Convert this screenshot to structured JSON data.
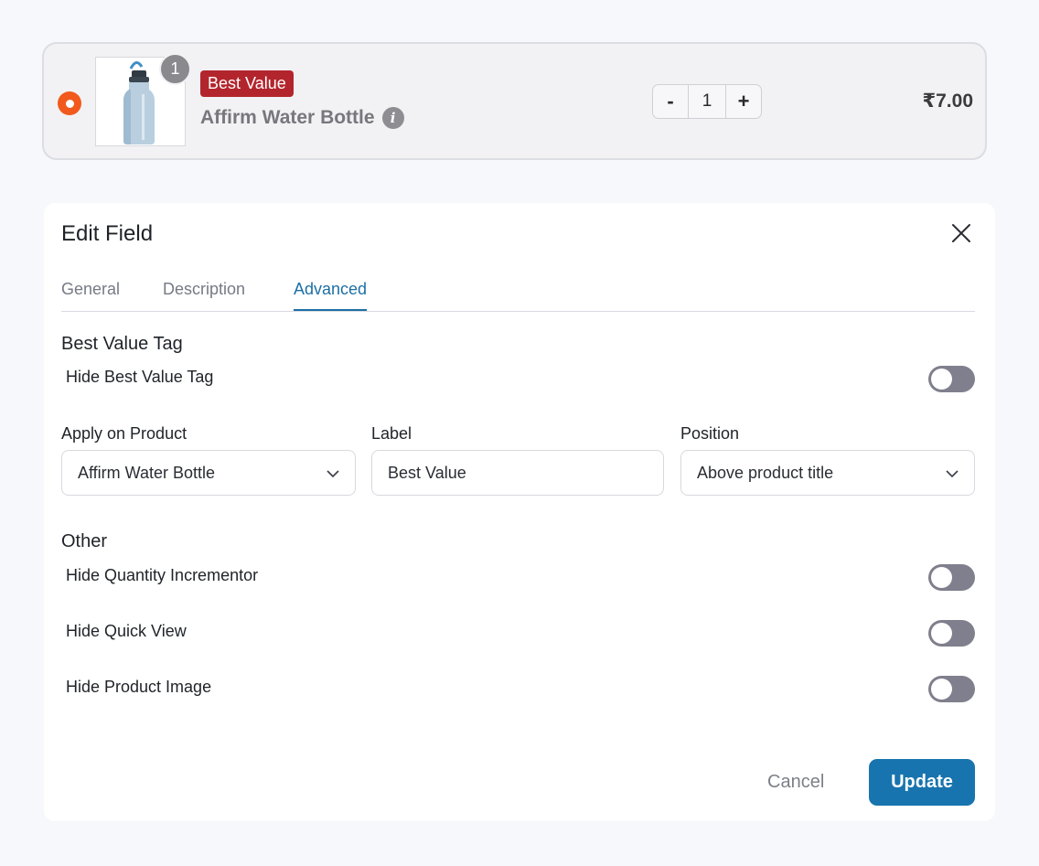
{
  "product": {
    "quantity_badge": "1",
    "tag": "Best Value",
    "title": "Affirm Water Bottle",
    "info_icon": "i",
    "stepper": {
      "minus": "-",
      "value": "1",
      "plus": "+"
    },
    "price": "₹7.00"
  },
  "modal": {
    "title": "Edit Field",
    "tabs": [
      {
        "label": "General",
        "active": false
      },
      {
        "label": "Description",
        "active": false
      },
      {
        "label": "Advanced",
        "active": true
      }
    ],
    "best_value_section": {
      "title": "Best Value Tag",
      "hide_tag_label": "Hide Best Value Tag",
      "hide_tag_on": false
    },
    "fields": {
      "apply_on_product": {
        "label": "Apply on Product",
        "value": "Affirm Water Bottle"
      },
      "label": {
        "label": "Label",
        "value": "Best Value"
      },
      "position": {
        "label": "Position",
        "value": "Above product title"
      }
    },
    "other_section": {
      "title": "Other",
      "toggles": [
        {
          "label": "Hide Quantity Incrementor",
          "on": false
        },
        {
          "label": "Hide Quick View",
          "on": false
        },
        {
          "label": "Hide Product Image",
          "on": false
        }
      ]
    },
    "buttons": {
      "cancel": "Cancel",
      "update": "Update"
    }
  },
  "colors": {
    "accent": "#1874ae",
    "tag": "#b3252d",
    "radio": "#f15a1c",
    "toggle_off": "#7f7f8d"
  }
}
